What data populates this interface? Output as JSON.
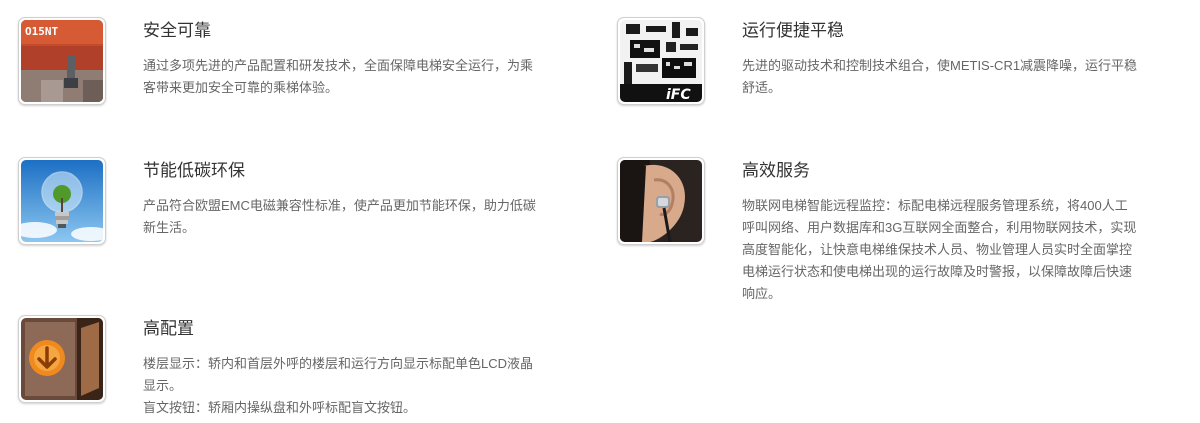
{
  "features": [
    {
      "title": "安全可靠",
      "image_icon": "elevator-control-panel-icon",
      "desc": "通过多项先进的产品配置和研发技术，全面保障电梯安全运行，为乘\n客带来更加安全可靠的乘梯体验。"
    },
    {
      "title": "运行便捷平稳",
      "image_icon": "circuit-board-icon",
      "desc": "先进的驱动技术和控制技术组合，使METIS-CR1减震降噪，运行平稳\n舒适。"
    },
    {
      "title": "节能低碳环保",
      "image_icon": "eco-light-bulb-icon",
      "desc": "产品符合欧盟EMC电磁兼容性标准，使产品更加节能环保，助力低碳\n新生活。"
    },
    {
      "title": "高效服务",
      "image_icon": "earpiece-icon",
      "desc": "物联网电梯智能远程监控：标配电梯远程服务管理系统，将400人工\n呼叫网络、用户数据库和3G互联网全面整合，利用物联网技术，实现\n高度智能化，让快意电梯维保技术人员、物业管理人员实时全面掌控\n电梯运行状态和使电梯出现的运行故障及时警报，以保障故障后快速\n响应。"
    },
    {
      "title": "高配置",
      "image_icon": "elevator-call-button-icon",
      "desc": "楼层显示：轿内和首层外呼的楼层和运行方向显示标配单色LCD液晶\n显示。\n盲文按钮：轿厢内操纵盘和外呼标配盲文按钮。"
    }
  ],
  "panel_label": "O15NT",
  "board_label": "iFC"
}
